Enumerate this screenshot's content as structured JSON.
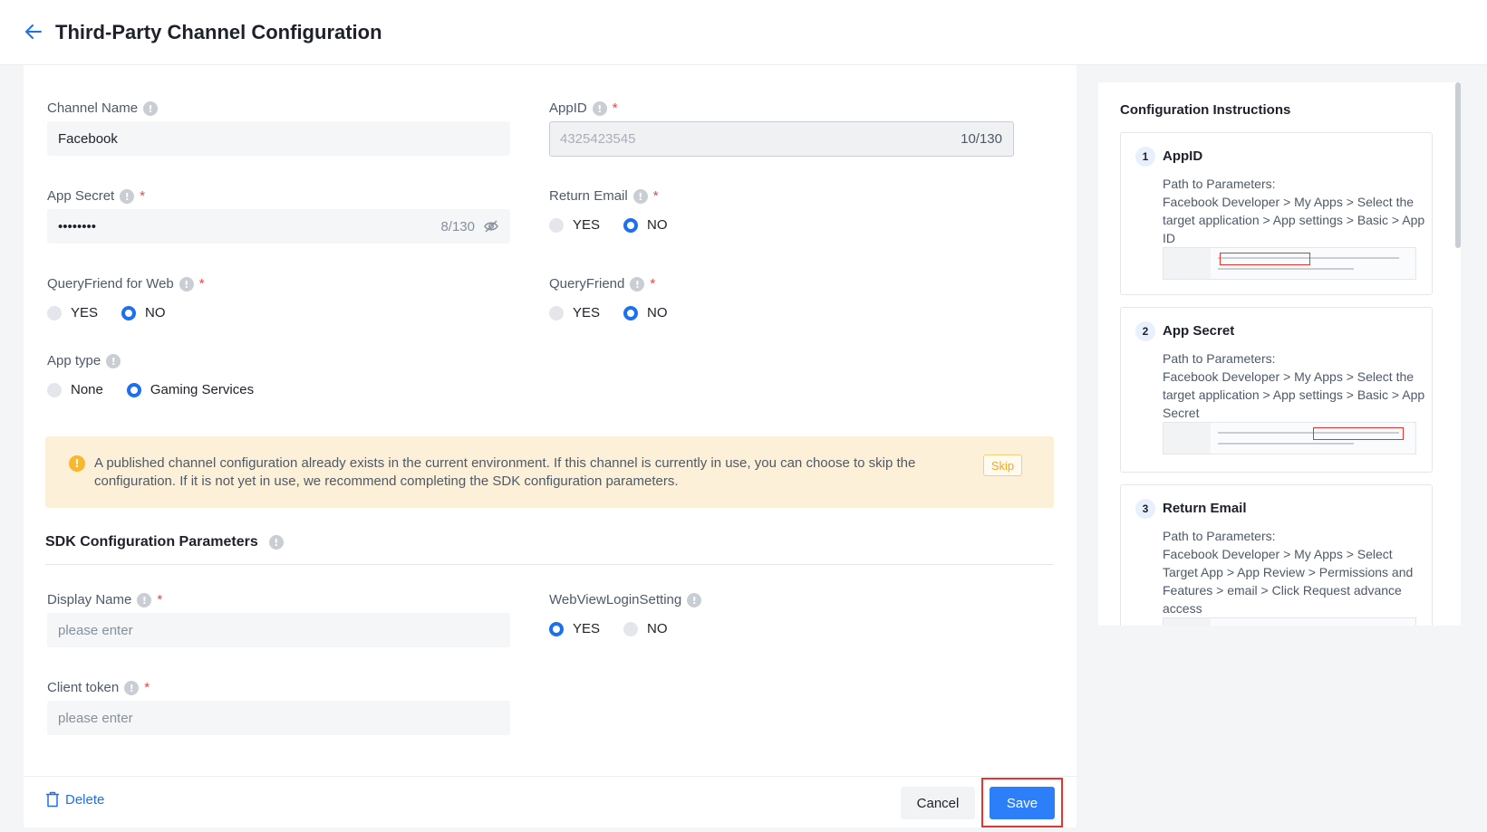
{
  "header": {
    "title": "Third-Party Channel Configuration",
    "back_icon": "arrow-left-icon"
  },
  "form": {
    "channel_name": {
      "label": "Channel Name",
      "value": "Facebook"
    },
    "app_id": {
      "label": "AppID",
      "value": "4325423545",
      "counter": "10/130"
    },
    "app_secret": {
      "label": "App Secret",
      "value": "••••••••",
      "counter": "8/130"
    },
    "return_email": {
      "label": "Return Email",
      "options": [
        "YES",
        "NO"
      ],
      "selected": "NO"
    },
    "query_friend_web": {
      "label": "QueryFriend for Web",
      "options": [
        "YES",
        "NO"
      ],
      "selected": "NO"
    },
    "query_friend": {
      "label": "QueryFriend",
      "options": [
        "YES",
        "NO"
      ],
      "selected": "NO"
    },
    "app_type": {
      "label": "App type",
      "options": [
        "None",
        "Gaming Services"
      ],
      "selected": "Gaming Services"
    },
    "required_mark": "*",
    "info_mark": "!"
  },
  "notice": {
    "text": "A published channel configuration already exists in the current environment. If this channel is currently in use, you can choose to skip the configuration. If it is not yet in use, we recommend completing the SDK configuration parameters.",
    "skip_label": "Skip",
    "icon_mark": "!"
  },
  "sdk": {
    "title": "SDK Configuration Parameters",
    "display_name": {
      "label": "Display Name",
      "placeholder": "please enter"
    },
    "webview_login": {
      "label": "WebViewLoginSetting",
      "options": [
        "YES",
        "NO"
      ],
      "selected": "YES"
    },
    "client_token": {
      "label": "Client token",
      "placeholder": "please enter"
    }
  },
  "footer": {
    "delete_label": "Delete",
    "cancel_label": "Cancel",
    "save_label": "Save"
  },
  "instructions": {
    "title": "Configuration Instructions",
    "steps": [
      {
        "num": "1",
        "title": "AppID",
        "body": "Path to Parameters:\nFacebook Developer > My Apps > Select the target application > App settings > Basic > App ID"
      },
      {
        "num": "2",
        "title": "App Secret",
        "body": "Path to Parameters:\nFacebook Developer > My Apps > Select the target application > App settings > Basic > App Secret"
      },
      {
        "num": "3",
        "title": "Return Email",
        "body": "Path to Parameters:\nFacebook Developer > My Apps > Select Target App > App Review > Permissions and Features > email > Click Request advance access"
      }
    ]
  },
  "colors": {
    "primary": "#2d7ff9",
    "danger": "#e8332f",
    "warning_bg": "#fdf0d8",
    "warning_icon": "#fbb72c"
  }
}
